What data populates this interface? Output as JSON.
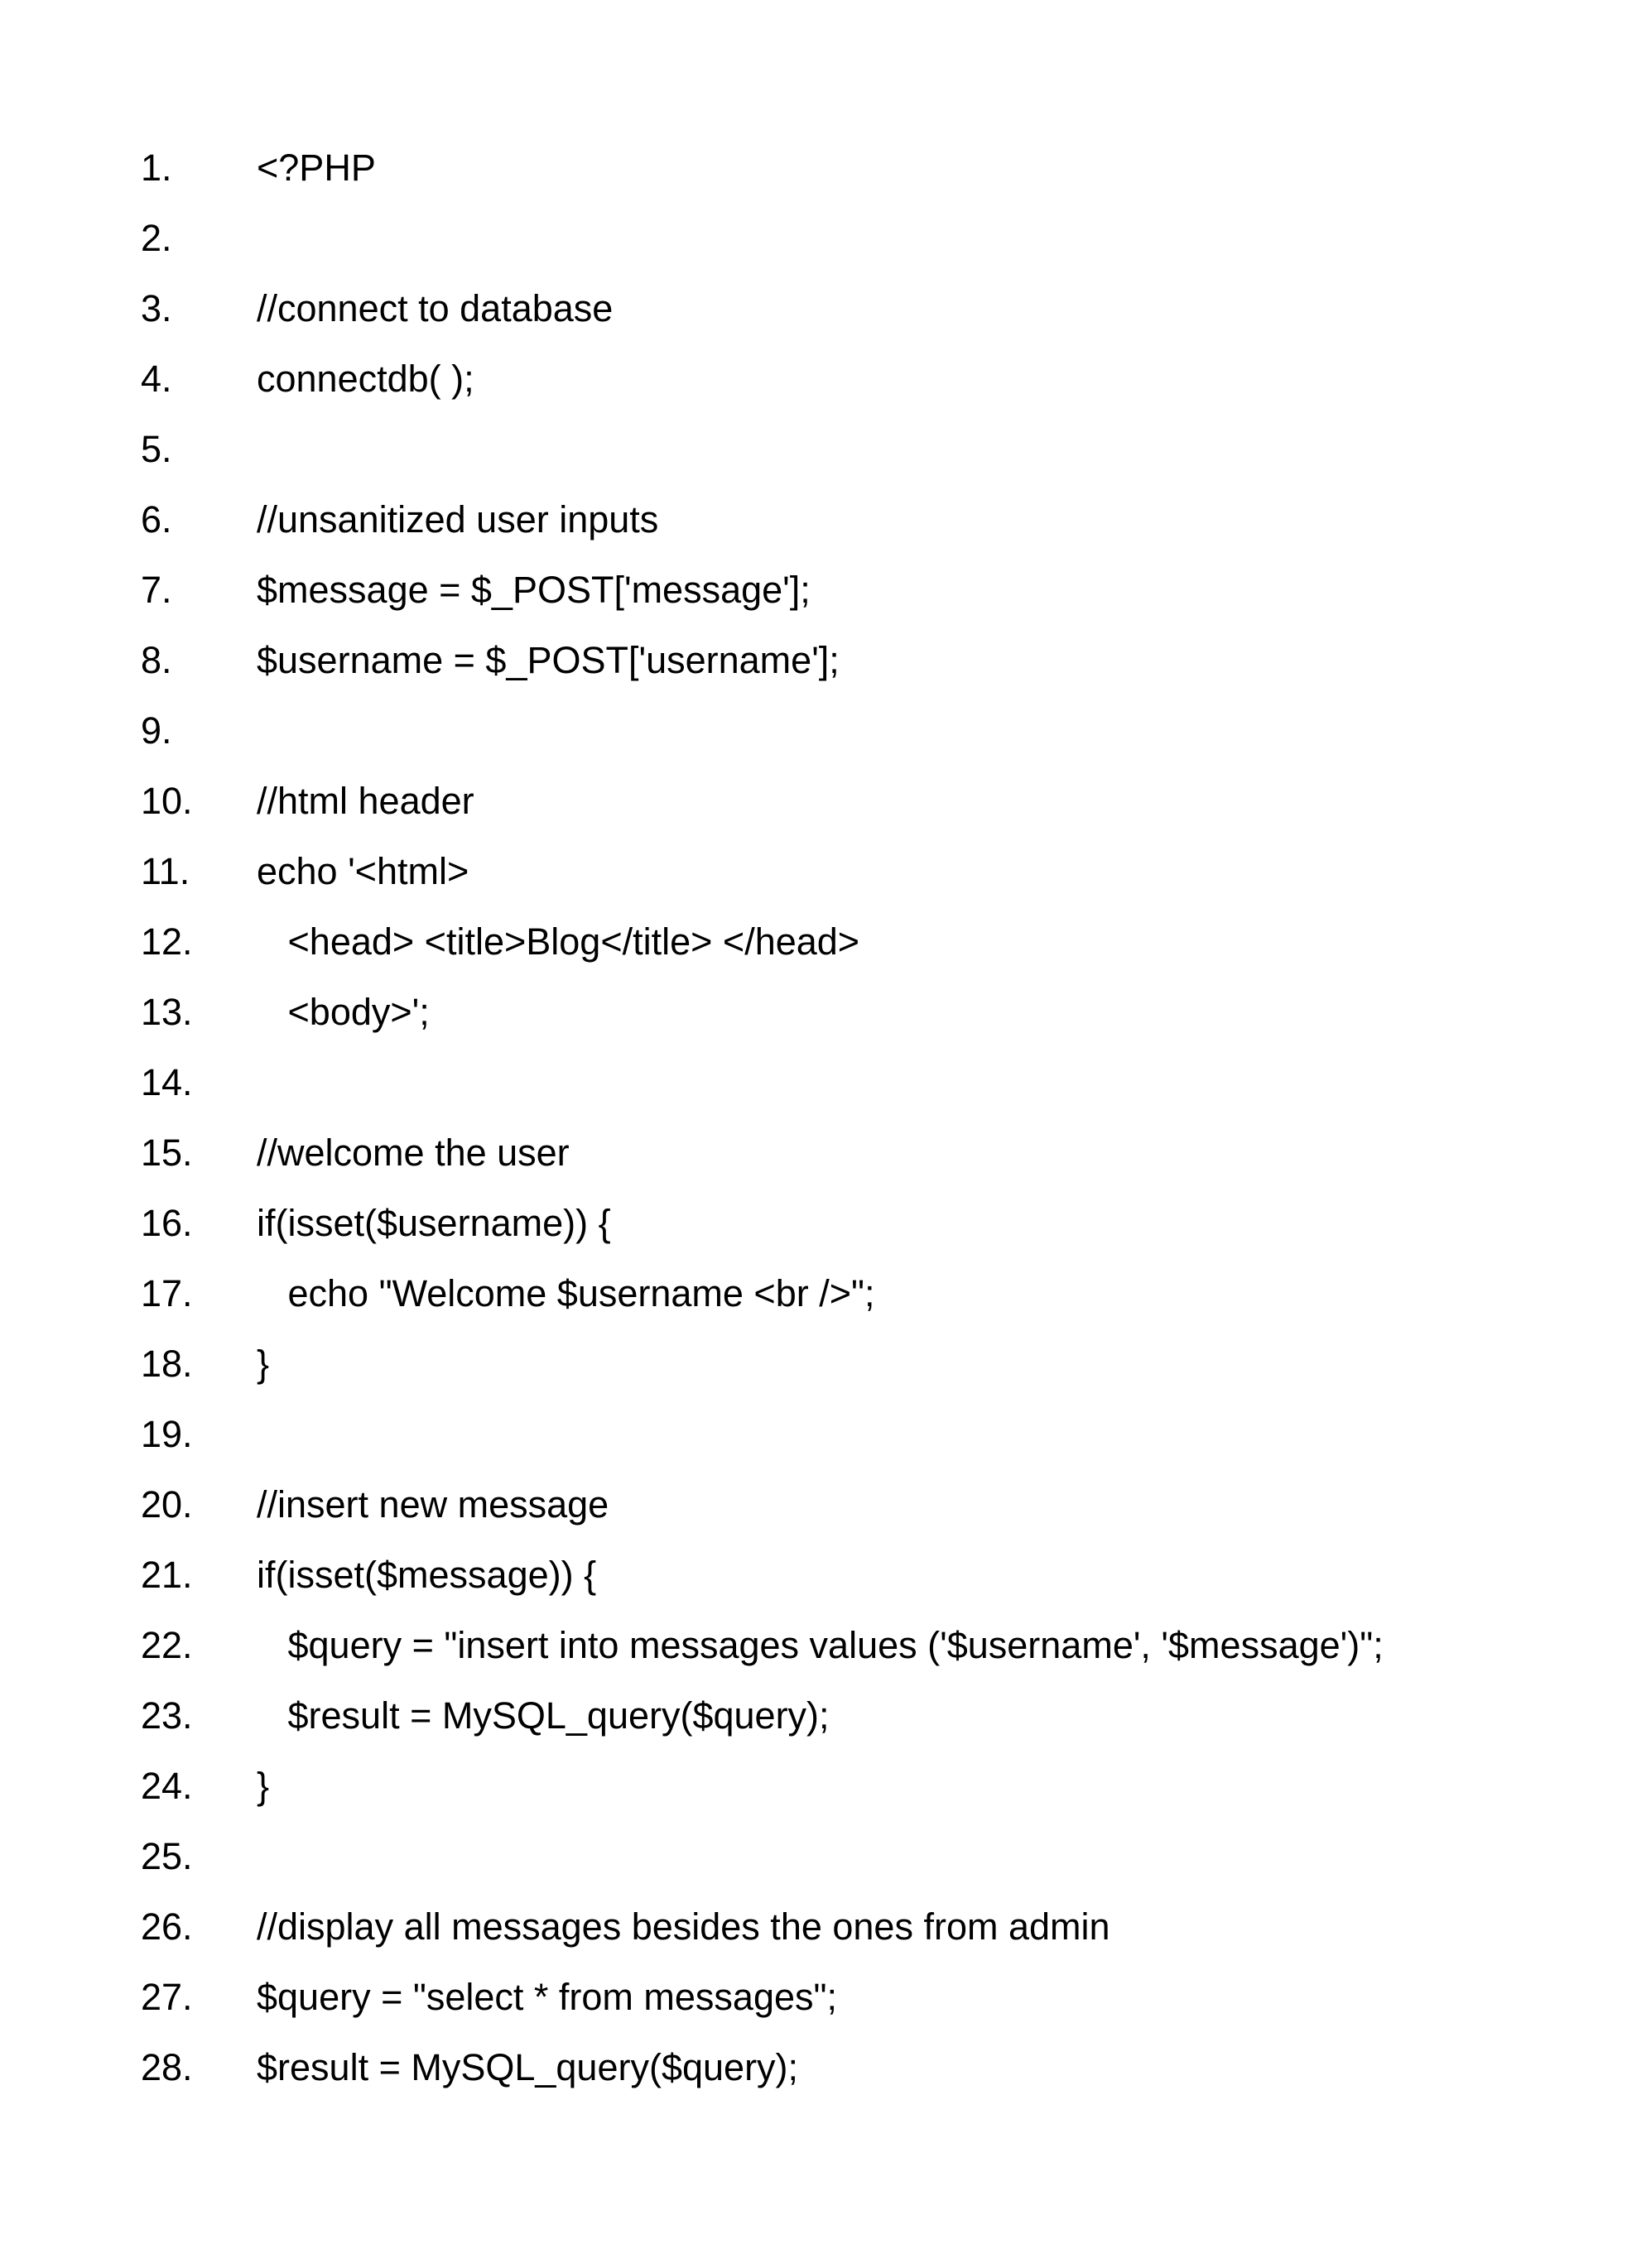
{
  "lines": [
    {
      "n": "1.",
      "t": "<?PHP"
    },
    {
      "n": "2.",
      "t": ""
    },
    {
      "n": "3.",
      "t": "//connect to database"
    },
    {
      "n": "4.",
      "t": "connectdb( );"
    },
    {
      "n": "5.",
      "t": ""
    },
    {
      "n": "6.",
      "t": "//unsanitized user inputs"
    },
    {
      "n": "7.",
      "t": "$message = $_POST['message'];"
    },
    {
      "n": "8.",
      "t": "$username = $_POST['username'];"
    },
    {
      "n": "9.",
      "t": ""
    },
    {
      "n": "10.",
      "t": "//html header"
    },
    {
      "n": "11.",
      "t": "echo '<html>"
    },
    {
      "n": "12.",
      "t": "   <head> <title>Blog</title> </head>"
    },
    {
      "n": "13.",
      "t": "   <body>';"
    },
    {
      "n": "14.",
      "t": ""
    },
    {
      "n": "15.",
      "t": "//welcome the user"
    },
    {
      "n": "16.",
      "t": "if(isset($username)) {"
    },
    {
      "n": "17.",
      "t": "   echo \"Welcome $username <br />\";"
    },
    {
      "n": "18.",
      "t": "}"
    },
    {
      "n": "19.",
      "t": ""
    },
    {
      "n": "20.",
      "t": "//insert new message"
    },
    {
      "n": "21.",
      "t": "if(isset($message)) {"
    },
    {
      "n": "22.",
      "t": "   $query = \"insert into messages values ('$username', '$message')\";"
    },
    {
      "n": "23.",
      "t": "   $result = MySQL_query($query);"
    },
    {
      "n": "24.",
      "t": "}"
    },
    {
      "n": "25.",
      "t": ""
    },
    {
      "n": "26.",
      "t": "//display all messages besides the ones from admin"
    },
    {
      "n": "27.",
      "t": "$query = \"select * from messages\";"
    },
    {
      "n": "28.",
      "t": "$result = MySQL_query($query);"
    }
  ]
}
